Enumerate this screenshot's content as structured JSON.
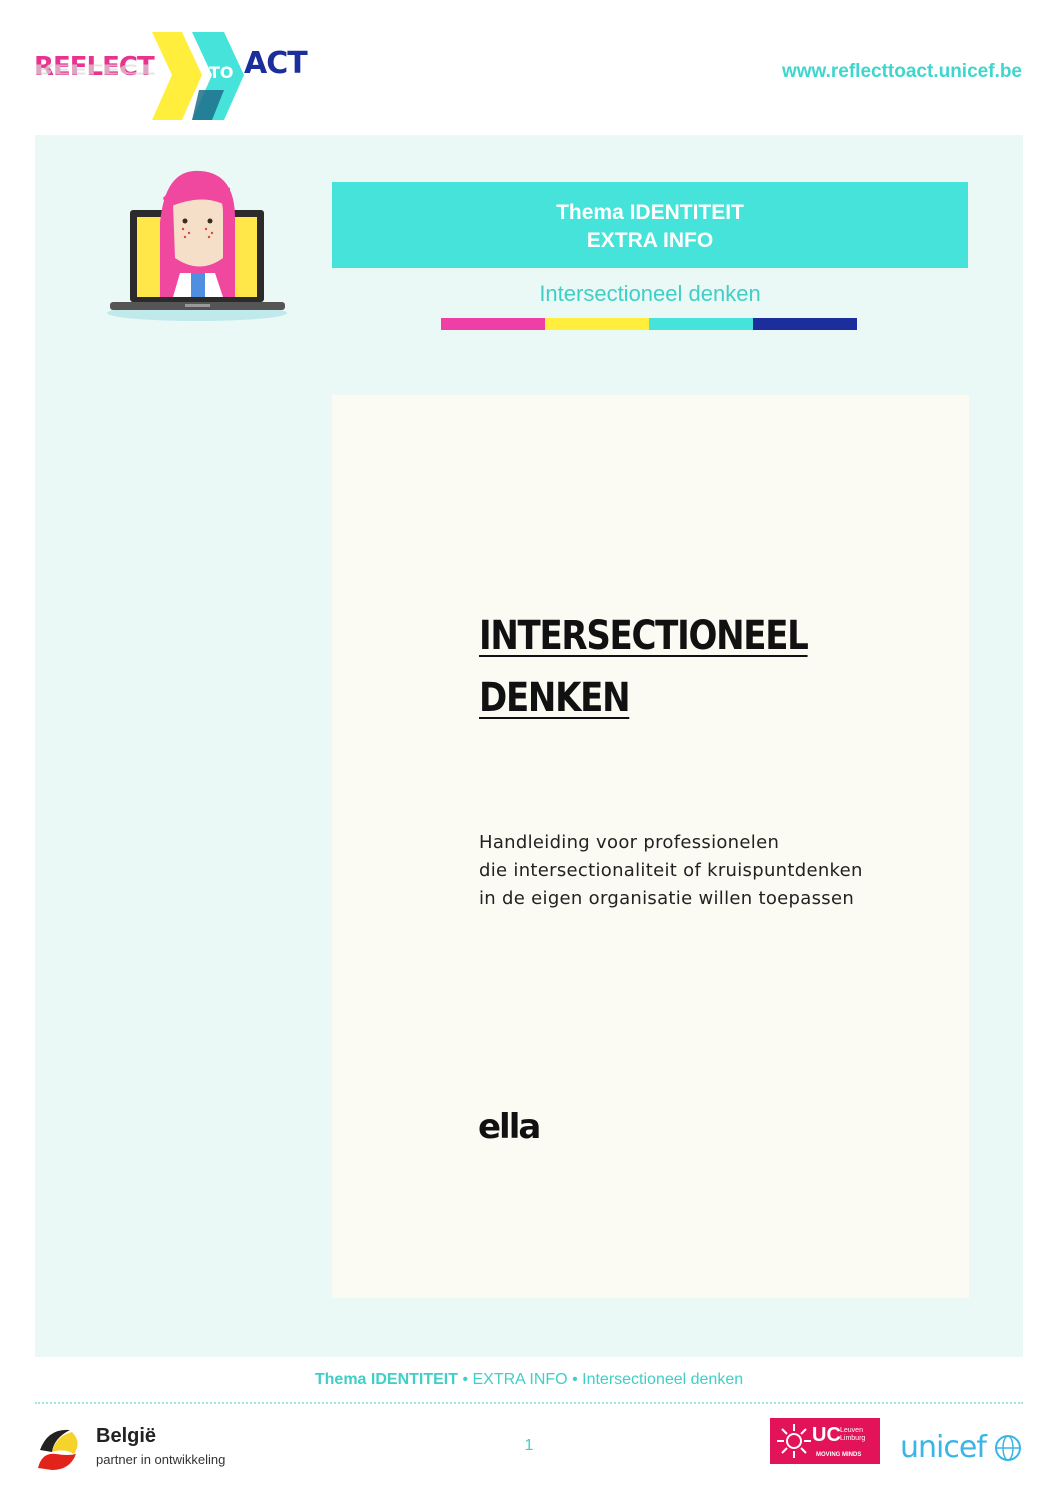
{
  "header": {
    "logo": {
      "word_reflect": "REFLECT",
      "word_to": "TO",
      "word_act": "ACT",
      "icon": "reflect-to-act-logo"
    },
    "url": "www.reflecttoact.unicef.be"
  },
  "theme": {
    "banner_line1": "Thema IDENTITEIT",
    "banner_line2": "EXTRA INFO",
    "subtitle": "Intersectioneel denken",
    "color_bar": [
      "#ef3fa6",
      "#ffee3b",
      "#45e3d9",
      "#1c2e9c"
    ]
  },
  "document": {
    "title_line1": "INTERSECTIONEEL",
    "title_line2": "DENKEN",
    "description_line1": "Handleiding voor professionelen",
    "description_line2": "die intersectionaliteit of kruispuntdenken",
    "description_line3": "in de eigen organisatie willen toepassen",
    "publisher_logo": "ella"
  },
  "footer": {
    "theme_bold": "Thema IDENTITEIT",
    "separator": " • ",
    "extra": "EXTRA INFO",
    "topic": "Intersectioneel denken",
    "page_number": "1",
    "belgie_title": "België",
    "belgie_subtitle": "partner in ontwikkeling",
    "ucll_uc": "UC",
    "ucll_name_line1": "Leuven",
    "ucll_name_line2": "Limburg",
    "ucll_tagline": "MOVING MINDS",
    "unicef": "unicef"
  }
}
